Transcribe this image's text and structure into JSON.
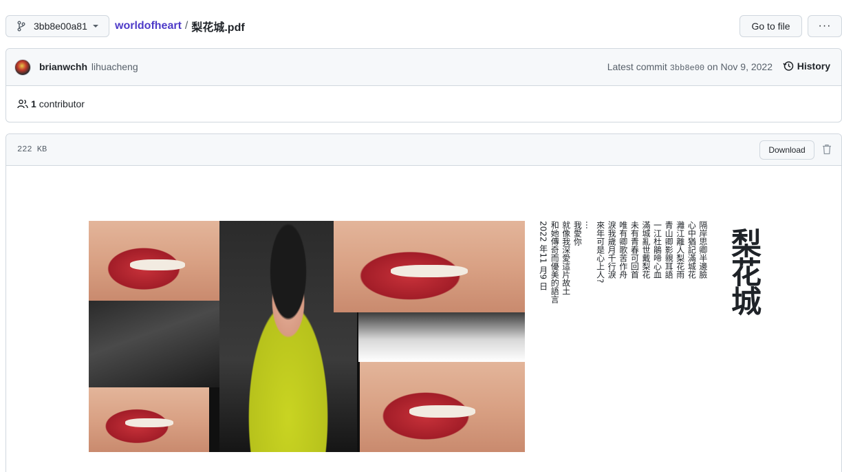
{
  "topbar": {
    "branch": "3bb8e00a81",
    "repo": "worldofheart",
    "separator": "/",
    "file": "梨花城.pdf",
    "goto_label": "Go to file",
    "more_label": "···"
  },
  "commit": {
    "author": "brianwchh",
    "coauthor": "lihuacheng",
    "latest_prefix": "Latest commit",
    "sha": "3bb8e00",
    "date_text": "on Nov 9, 2022",
    "history_label": "History"
  },
  "contributors": {
    "count": "1",
    "label": "contributor"
  },
  "file": {
    "size": "222 KB",
    "download_label": "Download"
  },
  "pdf": {
    "title": "梨花城",
    "poem_columns": [
      "隔岸思卿半邊臉",
      "心中猶記滿城花",
      "灕江離人梨花雨",
      "青山卿影親耳語",
      "一江杜鵑啼心血",
      "滿城亂世戴梨花",
      "未有青春可回首",
      "唯有卿歌苦作舟",
      "淚我歲月千行淚",
      "來年可是心上人?",
      "…",
      "我愛你",
      "就像我深愛這片故土",
      "和她傳奇而優美的語言",
      "2022 年11 月9 日"
    ]
  }
}
